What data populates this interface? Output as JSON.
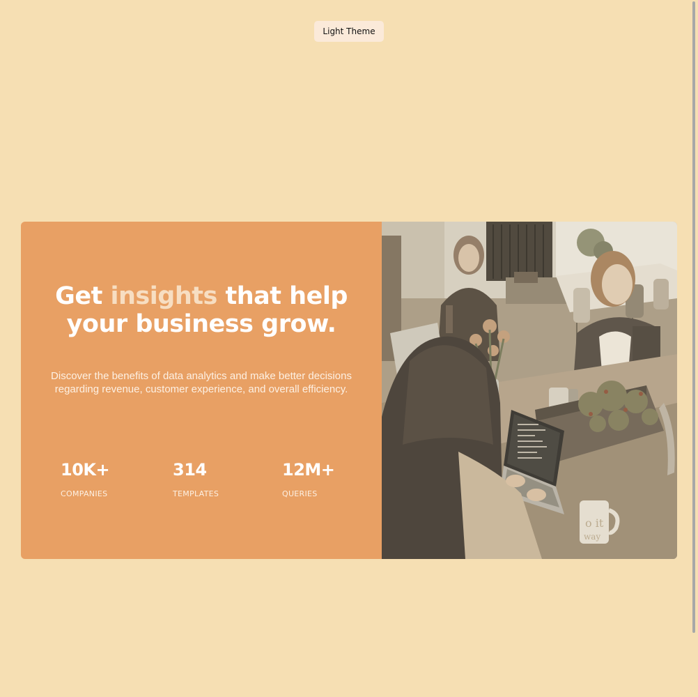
{
  "theme_toggle": {
    "label": "Light Theme"
  },
  "hero": {
    "headline_before": "Get ",
    "headline_accent": "insights",
    "headline_after_line1": " that help",
    "headline_line2": "your business grow.",
    "description": "Discover the benefits of data analytics and make better decisions regarding revenue, customer experience, and overall efficiency.",
    "stats": [
      {
        "value": "10K+",
        "label": "COMPANIES"
      },
      {
        "value": "314",
        "label": "TEMPLATES"
      },
      {
        "value": "12M+",
        "label": "QUERIES"
      }
    ],
    "mug_text_1": "o it",
    "mug_text_2": "way"
  },
  "colors": {
    "page_background": "#f6dfb3",
    "card_panel": "#e8a064",
    "accent_text": "#f7dec2",
    "button_background": "#fbead9"
  },
  "icons": {
    "photo": "office-team-photo"
  }
}
